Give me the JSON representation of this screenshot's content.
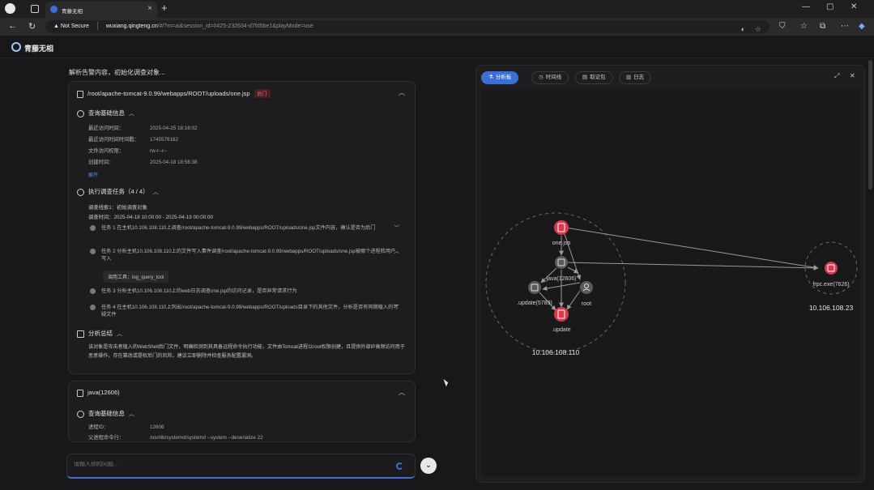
{
  "browser": {
    "tab_title": "青藤无相",
    "new_tab_label": "+",
    "security_label": "Not Secure",
    "url_host": "wuxiang.qingteng.cn",
    "url_path": "/#/?m=ai&session_id=0425-232634-d7fd5be1&playMode=use"
  },
  "app": {
    "name": "青藤无相"
  },
  "chat": {
    "intro": "解析告警内容，初始化调查对象...",
    "card1": {
      "title": "/root/apache-tomcat-9.0.99/webapps/ROOT/uploads/one.jsp",
      "badge": "后门",
      "basic_section": "查询基础信息",
      "basic_rows": [
        {
          "k": "最近访问时间：",
          "v": "2025-04-25 18:16:02"
        },
        {
          "k": "最近访问时间时间戳：",
          "v": "1745576162"
        },
        {
          "k": "文件访问权限：",
          "v": "rw-r--r--"
        },
        {
          "k": "创建时间：",
          "v": "2025-04-18 18:56:38"
        }
      ],
      "expand_link": "展开",
      "tasks_section": "执行调查任务（4 / 4）",
      "clue_line": "调查线索1：初始调查对象",
      "time_line": "调查时间：2025-04-18 10:00:00 - 2025-04-19 00:00:00",
      "tasks": [
        "任务 1 在主机10.106.108.110上调查/root/apache-tomcat-9.0.99/webapps/ROOT/uploads/one.jsp文件内容，确认是否为后门",
        "任务 2 分析主机10.106.108.110上的文件写入事件调查/root/apache-tomcat-9.0.99/webapps/ROOT/uploads/one.jsp被哪个进程和用户写入",
        "任务 3 分析主机10.106.108.110上的web日志调查one.jsp的访问记录，是否异常请求行为",
        "任务 4 在主机10.106.108.110上列出/root/apache-tomcat-9.0.99/webapps/ROOT/uploads目录下的其他文件，分析是否有同期植入的可疑文件"
      ],
      "tool_call": "调用工具：log_query_tool",
      "summary_section": "分析总结",
      "summary_text": "该对象是攻击者植入的WebShell后门文件，明确检测到其具备远程命令执行功能，文件由Tomcat进程以root权限创建，且提供外部IP高频访问用于恶意操作，存在篡改或提权后门的风险，建议立即删除并检查服务配置漏洞。"
    },
    "card2": {
      "title": "java(12606)",
      "basic_section": "查询基础信息",
      "rows": [
        {
          "k": "进程ID：",
          "v": "12606"
        },
        {
          "k": "父进程命令行：",
          "v": "/usr/lib/systemd/systemd --system --deserialize 22"
        }
      ]
    },
    "input_placeholder": "请输入你的问题..."
  },
  "graph_panel": {
    "tabs": [
      {
        "label": "分析板",
        "icon": "⚗"
      },
      {
        "label": "时间线",
        "icon": "◷"
      },
      {
        "label": "取证包",
        "icon": "▤"
      },
      {
        "label": "日志",
        "icon": "▥"
      }
    ],
    "nodes": [
      {
        "label": "one.jsp",
        "type": "file-alert"
      },
      {
        "label": "java(12606)",
        "type": "process"
      },
      {
        "label": ".update(5789)",
        "type": "process"
      },
      {
        "label": "root",
        "type": "user"
      },
      {
        "label": ".update",
        "type": "file-alert"
      },
      {
        "label": "frpc.exe(7626)",
        "type": "process-alert"
      }
    ],
    "hosts": [
      "10.106.108.110",
      "10.106.108.23"
    ]
  },
  "colors": {
    "accent": "#3b6fd6",
    "alert": "#d63a4c",
    "node_grey": "#5a5a5e"
  }
}
